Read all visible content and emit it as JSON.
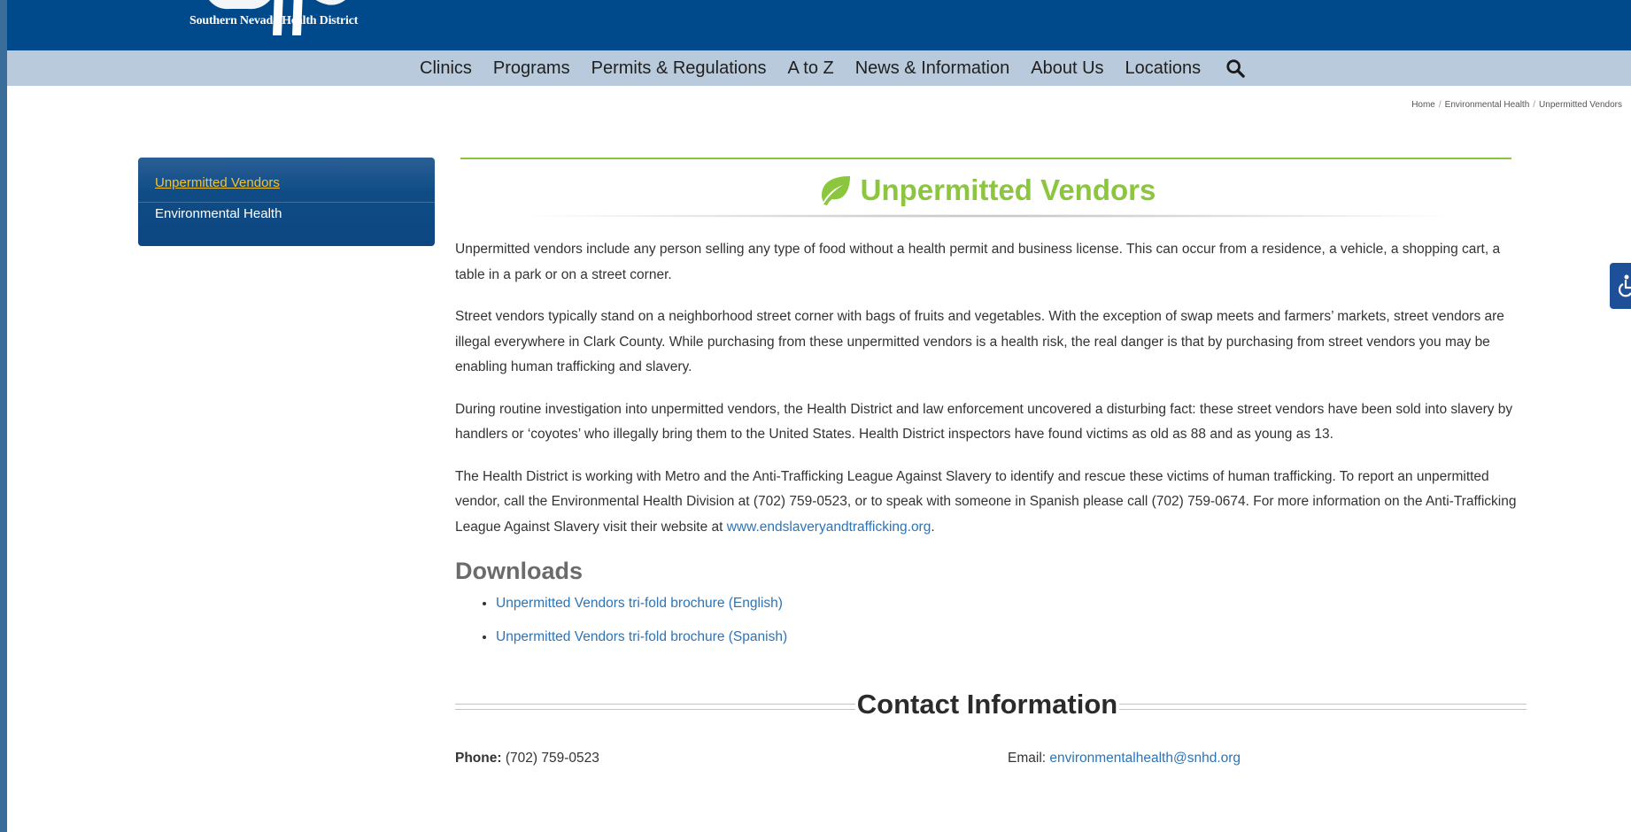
{
  "header": {
    "logo_text": "Southern Nevada Health District",
    "nav": [
      "Clinics",
      "Programs",
      "Permits & Regulations",
      "A to Z",
      "News & Information",
      "About Us",
      "Locations"
    ]
  },
  "breadcrumb": [
    "Home",
    "Environmental Health",
    "Unpermitted Vendors"
  ],
  "sidebar": {
    "items": [
      "Unpermitted Vendors",
      "Environmental Health"
    ]
  },
  "main": {
    "title": "Unpermitted Vendors",
    "paragraphs": [
      "Unpermitted vendors include any person selling any type of food without a health permit and business license. This can occur from a residence, a vehicle, a shopping cart, a table in a park or on a street corner.",
      "Street vendors typically stand on a neighborhood street corner with bags of fruits and vegetables. With the exception of swap meets and farmers’ markets, street vendors are illegal everywhere in Clark County. While purchasing from these unpermitted vendors is a health risk, the real danger is that by purchasing from street vendors you may be enabling human trafficking and slavery.",
      "During routine investigation into unpermitted vendors, the Health District and law enforcement uncovered a disturbing fact: these street vendors have been sold into slavery by handlers or ‘coyotes’ who illegally bring them to the United States. Health District inspectors have found victims as old as 88 and as young as 13."
    ],
    "paragraph4_text": "The Health District is working with Metro and the Anti-Trafficking League Against Slavery to identify and rescue these victims of human trafficking. To report an unpermitted vendor, call the Environmental Health Division at (702) 759-0523, or to speak with someone in Spanish please call (702) 759-0674. For more information on the Anti-Trafficking League Against Slavery visit their website at ",
    "paragraph4_link": "www.endslaveryandtrafficking.org",
    "paragraph4_end": ".",
    "downloads_heading": "Downloads",
    "downloads": [
      "Unpermitted Vendors tri-fold brochure (English)",
      "Unpermitted Vendors tri-fold brochure (Spanish)"
    ]
  },
  "contact": {
    "heading": "Contact Information",
    "phone_label": "Phone:",
    "phone_value": "(702) 759-0523",
    "email_label": "Email:",
    "email_value": "environmentalhealth@snhd.org"
  },
  "colors": {
    "header_blue": "#004a8b",
    "nav_bg": "#b8cadb",
    "accent_green": "#8cc63f",
    "link_blue": "#2d74b5",
    "sidebar_active": "#f2c230"
  },
  "icons": [
    "search-icon",
    "leaf-icon",
    "accessibility-icon"
  ]
}
